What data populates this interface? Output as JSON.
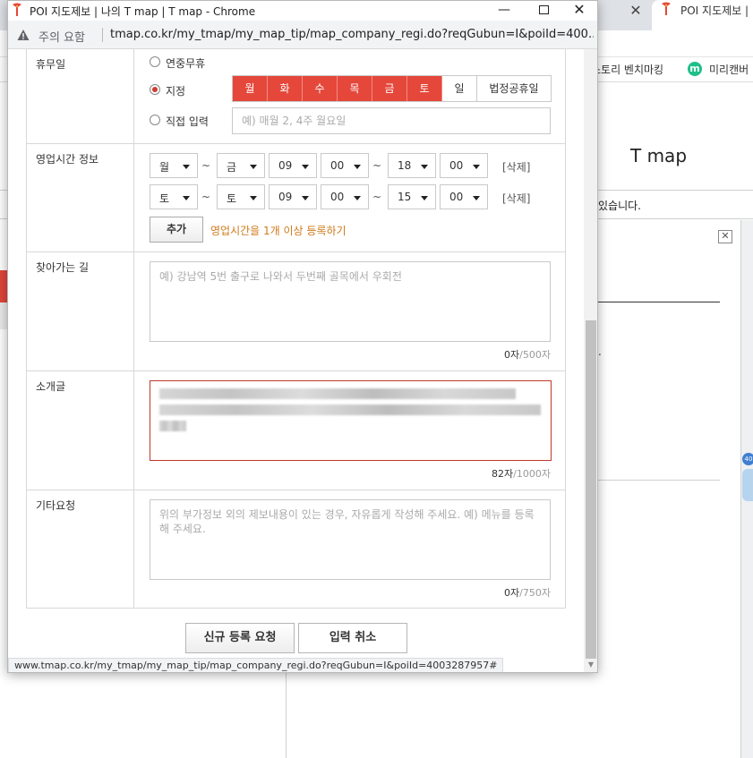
{
  "background": {
    "tab_title": "POI 지도제보 |",
    "bookmarks": [
      "스토리 벤치마킹",
      "미리캔버"
    ],
    "bookmark_m": "m",
    "page_heading": "T map",
    "notice_fragment": "있습니다.",
    "panel_close": "✕",
    "map_badge": "40",
    "dot_text": "."
  },
  "window": {
    "title": "POI 지도제보 | 나의 T map | T map - Chrome",
    "security_label": "주의 요함",
    "url": "tmap.co.kr/my_tmap/my_map_tip/map_company_regi.do?reqGubun=I&poiId=400...",
    "status_url": "www.tmap.co.kr/my_tmap/my_map_tip/map_company_regi.do?reqGubun=I&poiId=4003287957#"
  },
  "form": {
    "holiday": {
      "label": "휴무일",
      "options": [
        "연중무휴",
        "지정",
        "직접 입력"
      ],
      "selected": "지정",
      "days": [
        {
          "label": "월",
          "selected": true
        },
        {
          "label": "화",
          "selected": true
        },
        {
          "label": "수",
          "selected": true
        },
        {
          "label": "목",
          "selected": true
        },
        {
          "label": "금",
          "selected": true
        },
        {
          "label": "토",
          "selected": true
        },
        {
          "label": "일",
          "selected": false
        }
      ],
      "public_holiday": "법정공휴일",
      "direct_placeholder": "예) 매월 2, 4주 월요일"
    },
    "hours": {
      "label": "영업시간 정보",
      "rows": [
        {
          "day_from": "월",
          "day_to": "금",
          "open_h": "09",
          "open_m": "00",
          "close_h": "18",
          "close_m": "00"
        },
        {
          "day_from": "토",
          "day_to": "토",
          "open_h": "09",
          "open_m": "00",
          "close_h": "15",
          "close_m": "00"
        }
      ],
      "tilde": "~",
      "delete_label": "[삭제]",
      "add_label": "추가",
      "hint": "영업시간을 1개 이상 등록하기"
    },
    "directions": {
      "label": "찾아가는 길",
      "placeholder": "예) 강남역 5번 출구로 나와서 두번째 골목에서 우회전",
      "count": "0자",
      "max": "/500자"
    },
    "intro": {
      "label": "소개글",
      "count": "82자",
      "max": "/1000자"
    },
    "etc": {
      "label": "기타요청",
      "placeholder": "위의 부가정보 외의 제보내용이 있는 경우, 자유롭게 작성해 주세요. 예) 메뉴를 등록해 주세요.",
      "count": "0자",
      "max": "/750자"
    }
  },
  "actions": {
    "submit": "신규 등록 요청",
    "cancel": "입력 취소"
  },
  "colors": {
    "accent_red": "#e5473b",
    "hint_orange": "#d07a1a"
  }
}
